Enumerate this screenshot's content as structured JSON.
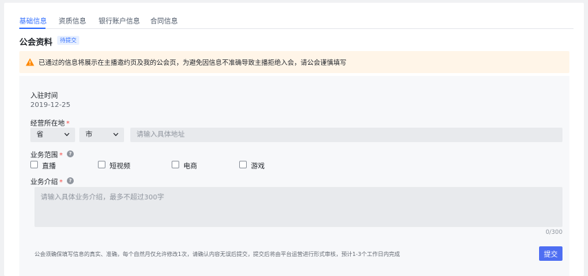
{
  "tabs": [
    {
      "label": "基础信息",
      "active": true
    },
    {
      "label": "资质信息",
      "active": false
    },
    {
      "label": "银行账户信息",
      "active": false
    },
    {
      "label": "合同信息",
      "active": false
    }
  ],
  "section": {
    "title": "公会资料",
    "status": "待提交"
  },
  "notice": {
    "text": "已通过的信息将展示在主播邀约页及我的公会页，为避免因信息不准确导致主播拒绝入会，请公会谨慎填写"
  },
  "form": {
    "join_time": {
      "label": "入驻时间",
      "value": "2019-12-25"
    },
    "location": {
      "label": "经营所在地",
      "required_mark": "*",
      "province": "省",
      "city": "市",
      "address_placeholder": "请输入具体地址"
    },
    "business_scope": {
      "label": "业务范围",
      "required_mark": "*",
      "help": "?",
      "options": [
        "直播",
        "短视频",
        "电商",
        "游戏"
      ]
    },
    "business_intro": {
      "label": "业务介绍",
      "required_mark": "*",
      "help": "?",
      "placeholder": "请输入具体业务介绍，最多不超过300字",
      "counter": "0/300"
    },
    "footer_note": "公会须确保填写信息的真实、准确，每个自然月仅允许修改1次，请确认内容无误后提交，提交后将由平台运营进行形式审核，预计1-3个工作日内完成",
    "submit_label": "提交"
  },
  "colors": {
    "accent": "#3370ff",
    "button": "#4e6ef2",
    "warning": "#ff8800",
    "required": "#f54a45"
  },
  "icons": {
    "notice": "warning-triangle-icon",
    "select": "chevron-down-icon",
    "help": "question-circle-icon"
  }
}
